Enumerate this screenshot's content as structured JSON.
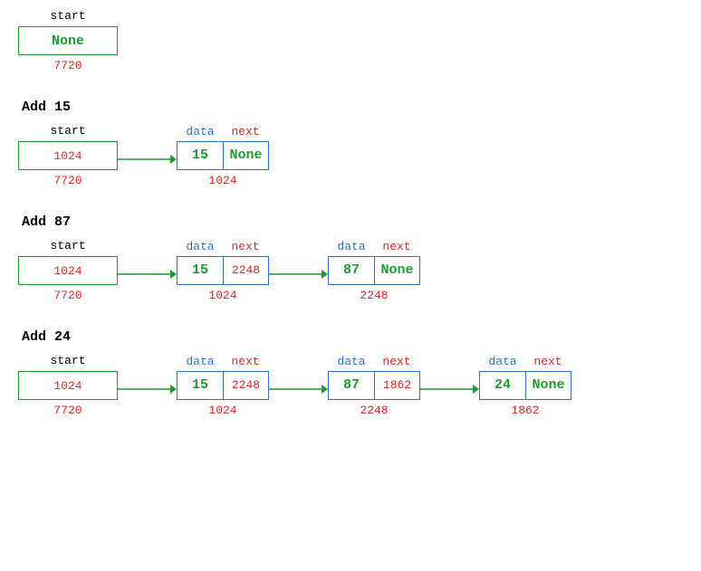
{
  "labels": {
    "start": "start",
    "data": "data",
    "next": "next",
    "none": "None"
  },
  "sections": [
    {
      "heading": null,
      "start": {
        "value": "None",
        "isNone": true,
        "addr": "7720"
      },
      "nodes": []
    },
    {
      "heading": "Add 15",
      "start": {
        "value": "1024",
        "isNone": false,
        "addr": "7720"
      },
      "nodes": [
        {
          "data": "15",
          "next": "None",
          "nextIsNone": true,
          "addr": "1024"
        }
      ]
    },
    {
      "heading": "Add 87",
      "start": {
        "value": "1024",
        "isNone": false,
        "addr": "7720"
      },
      "nodes": [
        {
          "data": "15",
          "next": "2248",
          "nextIsNone": false,
          "addr": "1024"
        },
        {
          "data": "87",
          "next": "None",
          "nextIsNone": true,
          "addr": "2248"
        }
      ]
    },
    {
      "heading": "Add 24",
      "start": {
        "value": "1024",
        "isNone": false,
        "addr": "7720"
      },
      "nodes": [
        {
          "data": "15",
          "next": "2248",
          "nextIsNone": false,
          "addr": "1024"
        },
        {
          "data": "87",
          "next": "1862",
          "nextIsNone": false,
          "addr": "2248"
        },
        {
          "data": "24",
          "next": "None",
          "nextIsNone": true,
          "addr": "1862"
        }
      ]
    }
  ]
}
